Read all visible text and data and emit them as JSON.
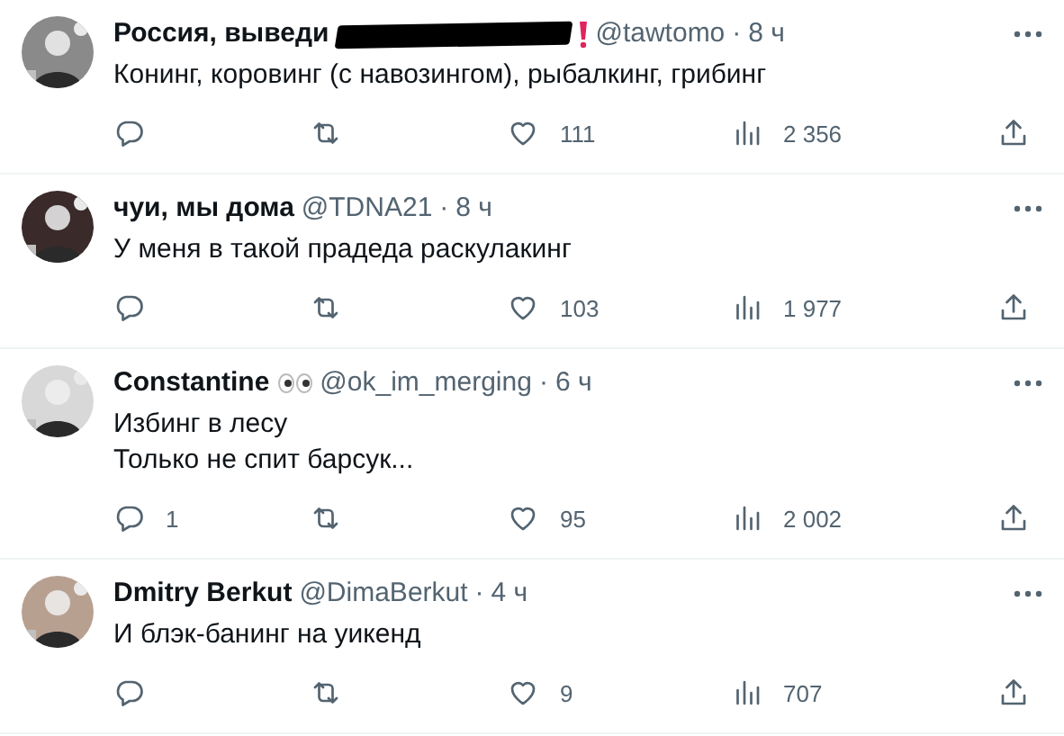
{
  "tweets": [
    {
      "name": "Россия, выведи",
      "redacted": true,
      "alert_mark": true,
      "handle": "@tawtomo",
      "separator": "·",
      "time": "8 ч",
      "text": [
        "Конинг, коровинг (с навозингом), рыбалкинг, грибинг"
      ],
      "likes": "111",
      "views": "2 356"
    },
    {
      "name": "чуи, мы дома",
      "handle": "@TDNA21",
      "separator": "·",
      "time": "8 ч",
      "text": [
        "У меня в такой прадеда раскулакинг"
      ],
      "likes": "103",
      "views": "1 977"
    },
    {
      "name": "Constantine",
      "eyes_mark": true,
      "handle": "@ok_im_merging",
      "separator": "·",
      "time": "6 ч",
      "text": [
        "Избинг в лесу",
        "Только не спит барсук..."
      ],
      "replies": "1",
      "likes": "95",
      "views": "2 002"
    },
    {
      "name": "Dmitry Berkut",
      "handle": "@DimaBerkut",
      "separator": "·",
      "time": "4 ч",
      "text": [
        "И блэк-банинг на уикенд"
      ],
      "likes": "9",
      "views": "707"
    }
  ]
}
